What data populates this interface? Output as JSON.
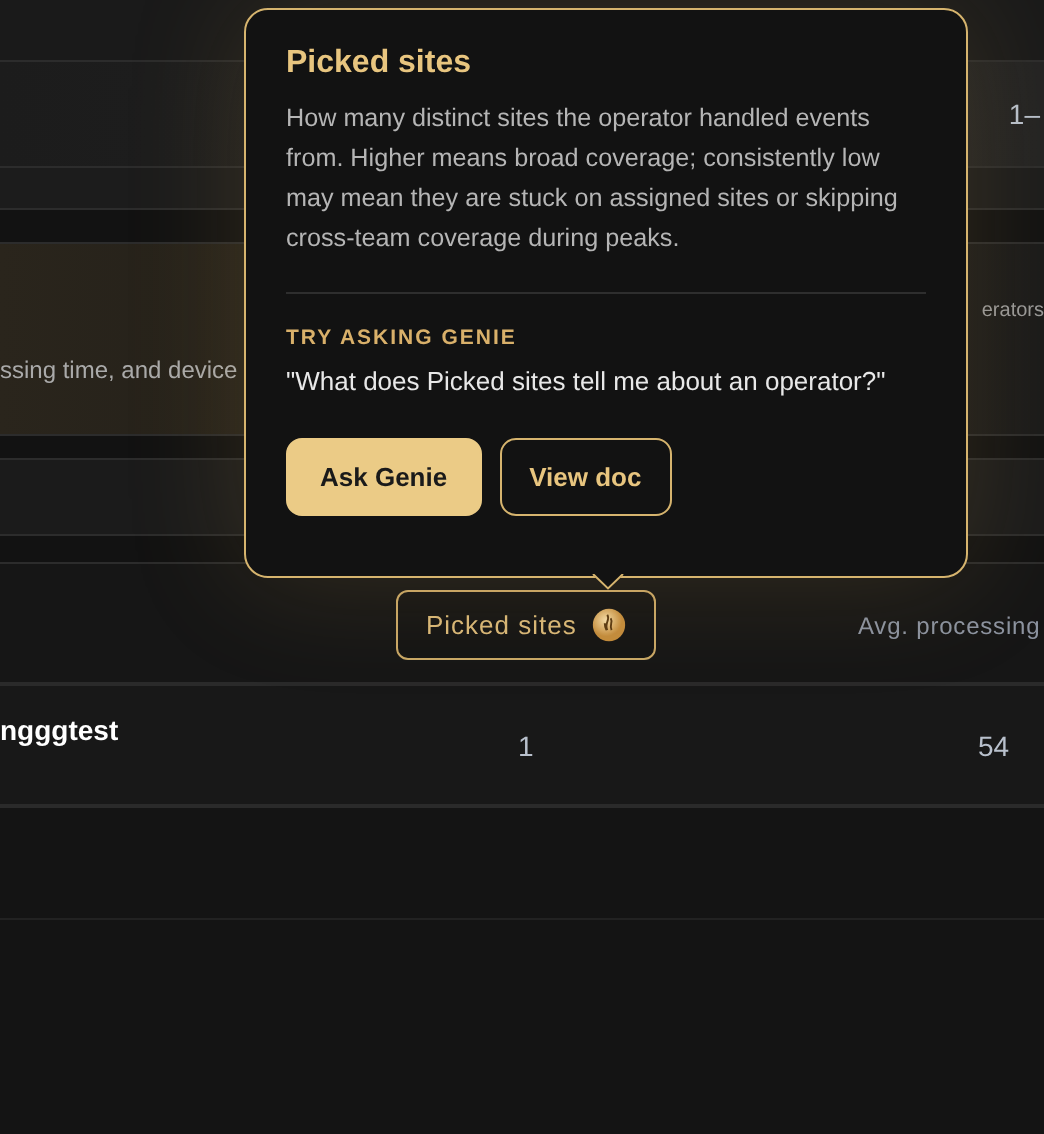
{
  "summary_row": {
    "range": "1–"
  },
  "banner": {
    "text": "ssing time, and device",
    "side_text": "erators"
  },
  "table": {
    "header": {
      "column_chip": {
        "label": "Picked sites",
        "active": true
      },
      "column_next": "Avg. processing"
    },
    "rows": [
      {
        "name": "ngggtest",
        "picked_sites": "1",
        "avg_processing": "54"
      }
    ]
  },
  "tooltip": {
    "title": "Picked sites",
    "body": "How many distinct sites the operator handled events from. Higher means broad coverage; consistently low may mean they are stuck on assigned sites or skipping cross-team coverage during peaks.",
    "section_label": "TRY ASKING GENIE",
    "prompt": "\"What does Picked sites tell me about an operator?\"",
    "buttons": [
      {
        "label": "Ask Genie",
        "kind": "primary"
      },
      {
        "label": "View doc",
        "kind": "secondary"
      }
    ]
  }
}
